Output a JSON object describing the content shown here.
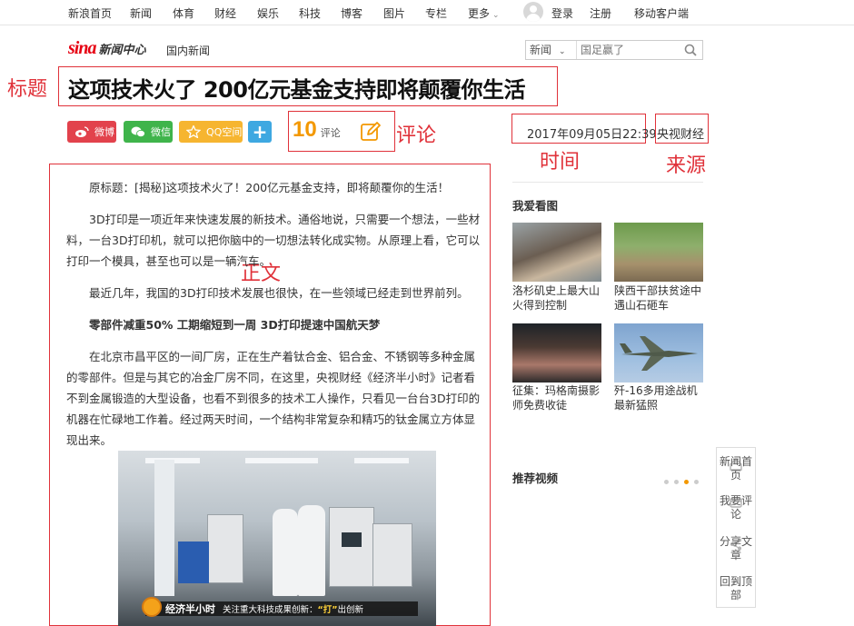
{
  "topnav": {
    "items": [
      "新浪首页",
      "新闻",
      "体育",
      "财经",
      "娱乐",
      "科技",
      "博客",
      "图片",
      "专栏",
      "更多"
    ],
    "login": "登录",
    "register": "注册",
    "mobile": "移动客户端"
  },
  "header": {
    "logo_sina": "sina",
    "logo_center": "新闻中心",
    "section": "国内新闻",
    "search_scope": "新闻",
    "search_placeholder": "国足赢了"
  },
  "annotations": {
    "title": "标题",
    "comment": "评论",
    "time": "时间",
    "source": "来源",
    "body": "正文"
  },
  "article": {
    "title": "这项技术火了 200亿元基金支持即将颠覆你生活",
    "share": {
      "weibo": "微博",
      "wechat": "微信",
      "qzone": "QQ空间",
      "plus": "+"
    },
    "comment_count": "10",
    "comment_label": "评论",
    "time": "2017年09月05日22:39",
    "source": "央视财经",
    "paragraphs": [
      "原标题：[揭秘]这项技术火了！200亿元基金支持，即将颠覆你的生活！",
      "3D打印是一项近年来快速发展的新技术。通俗地说，只需要一个想法，一些材料，一台3D打印机，就可以把你脑中的一切想法转化成实物。从原理上看，它可以打印一个模具，甚至也可以是一辆汽车。",
      "最近几年，我国的3D打印技术发展也很快，在一些领域已经走到世界前列。",
      "零部件减重50% 工期缩短到一周 3D打印提速中国航天梦",
      "在北京市昌平区的一间厂房，正在生产着钛合金、铝合金、不锈钢等多种金属的零部件。但是与其它的冶金厂房不同，在这里，央视财经《经济半小时》记者看不到金属锻造的大型设备，也看不到很多的技术工人操作，只看见一台台3D打印的机器在忙碌地工作着。经过两天时间，一个结构非常复杂和精巧的钛金属立方体显现出来。"
    ],
    "image_brand": "经济半小时",
    "image_caption_pre": "关注重大科技成果创新：",
    "image_caption_hl": "“打”",
    "image_caption_post": "出创新"
  },
  "sidebar": {
    "photos_title": "我爱看图",
    "photos": [
      {
        "caption": "洛杉矶史上最大山火得到控制"
      },
      {
        "caption": "陕西干部扶贫途中遇山石砸车"
      },
      {
        "caption": "征集：玛格南摄影师免费收徒"
      },
      {
        "caption": "歼-16多用途战机最新猛照"
      }
    ],
    "video_title": "推荐视频"
  },
  "floatbar": {
    "home": "新闻首页",
    "comment": "我要评论",
    "share": "分享文章",
    "top": "回到顶部"
  },
  "colors": {
    "annotation": "#e0323a",
    "weibo": "#e2424c",
    "wechat": "#3fb44b",
    "qzone": "#f6b530",
    "plus": "#3ea8e1",
    "comment_count": "#f39800"
  }
}
